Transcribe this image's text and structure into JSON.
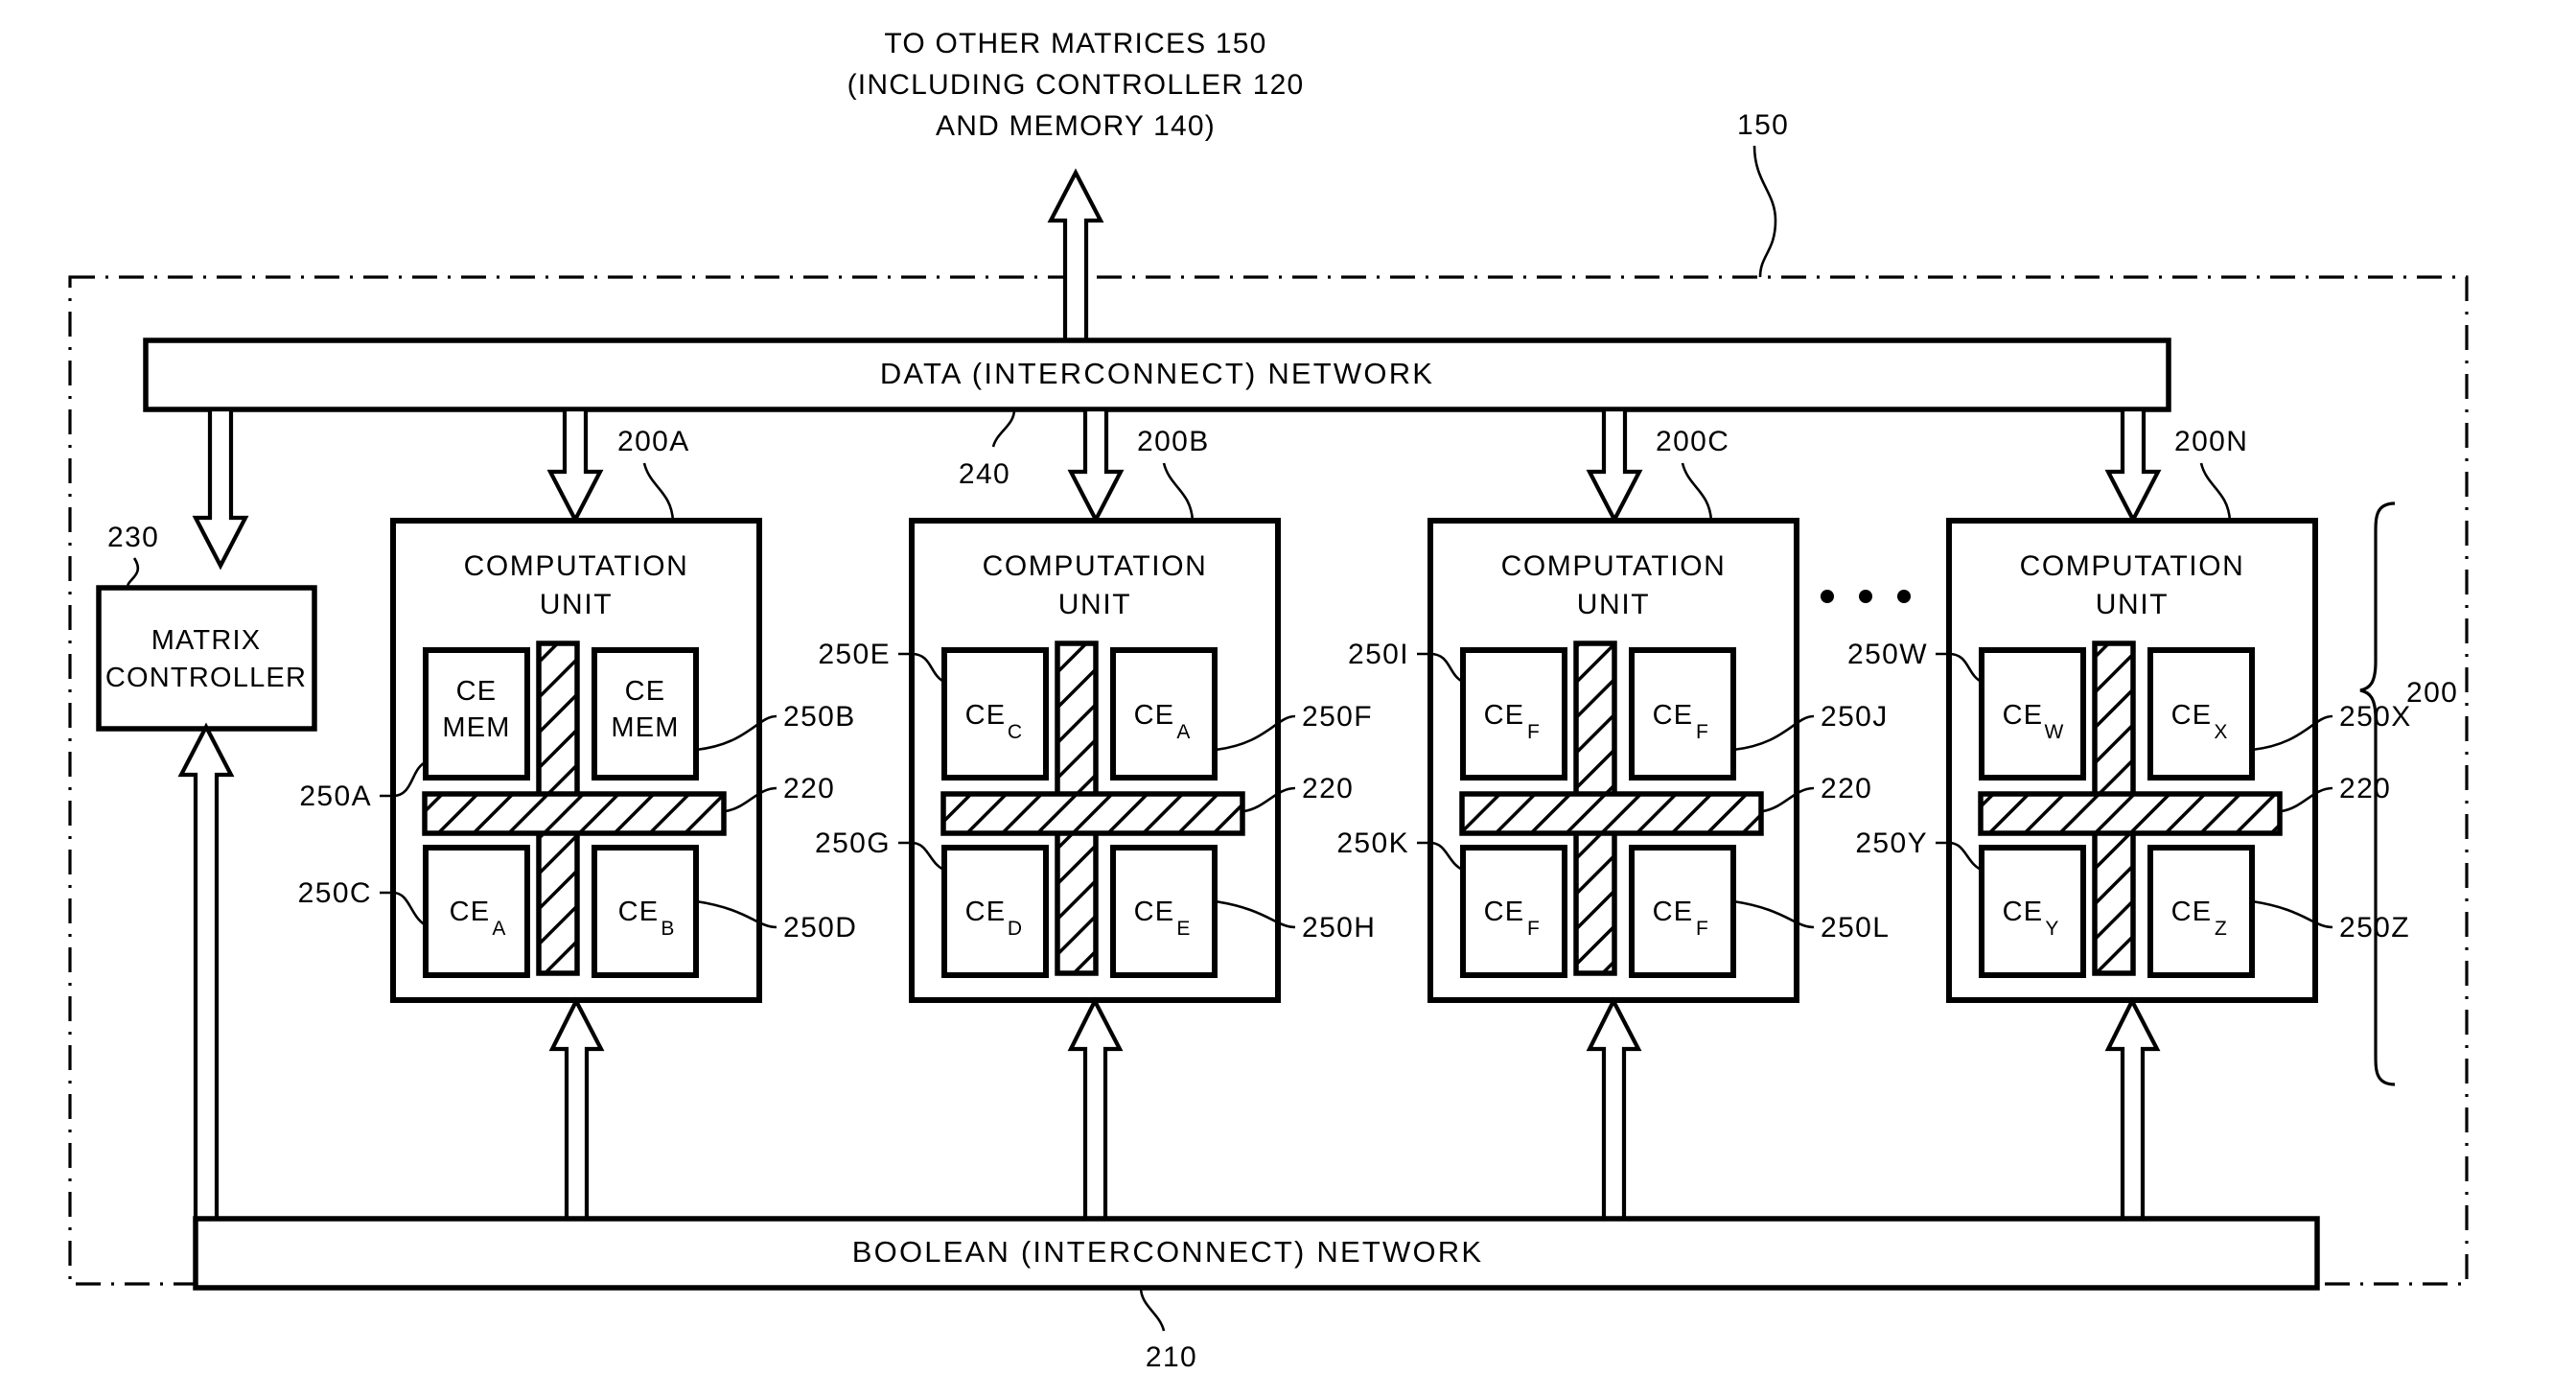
{
  "figure": {
    "top_note_lines": [
      "TO OTHER MATRICES 150",
      "(INCLUDING CONTROLLER 120",
      "AND MEMORY 140)"
    ],
    "outer_ref": "150",
    "data_network_label": "DATA (INTERCONNECT) NETWORK",
    "data_network_ref": "240",
    "boolean_network_label": "BOOLEAN (INTERCONNECT) NETWORK",
    "boolean_network_ref": "210",
    "matrix_controller_lines": [
      "MATRIX",
      "CONTROLLER"
    ],
    "matrix_controller_ref": "230",
    "matrix_brace_ref": "200",
    "ellipsis": "•  •  •",
    "unit_title_lines": [
      "COMPUTATION",
      "UNIT"
    ],
    "interconnect_ref": "220",
    "units": [
      {
        "ref": "200A",
        "cells": [
          {
            "label": "CE",
            "label2": "MEM",
            "sub": "",
            "ref": "250A",
            "ref_side": "left"
          },
          {
            "label": "CE",
            "label2": "MEM",
            "sub": "",
            "ref": "250B",
            "ref_side": "right"
          },
          {
            "label": "CE",
            "label2": "",
            "sub": "A",
            "ref": "250C",
            "ref_side": "left"
          },
          {
            "label": "CE",
            "label2": "",
            "sub": "B",
            "ref": "250D",
            "ref_side": "right"
          }
        ]
      },
      {
        "ref": "200B",
        "cells": [
          {
            "label": "CE",
            "label2": "",
            "sub": "C",
            "ref": "250E",
            "ref_side": "left"
          },
          {
            "label": "CE",
            "label2": "",
            "sub": "A",
            "ref": "250F",
            "ref_side": "right"
          },
          {
            "label": "CE",
            "label2": "",
            "sub": "D",
            "ref": "250G",
            "ref_side": "left"
          },
          {
            "label": "CE",
            "label2": "",
            "sub": "E",
            "ref": "250H",
            "ref_side": "right"
          }
        ]
      },
      {
        "ref": "200C",
        "cells": [
          {
            "label": "CE",
            "label2": "",
            "sub": "F",
            "ref": "250I",
            "ref_side": "left"
          },
          {
            "label": "CE",
            "label2": "",
            "sub": "F",
            "ref": "250J",
            "ref_side": "right"
          },
          {
            "label": "CE",
            "label2": "",
            "sub": "F",
            "ref": "250K",
            "ref_side": "left"
          },
          {
            "label": "CE",
            "label2": "",
            "sub": "F",
            "ref": "250L",
            "ref_side": "right"
          }
        ]
      },
      {
        "ref": "200N",
        "cells": [
          {
            "label": "CE",
            "label2": "",
            "sub": "W",
            "ref": "250W",
            "ref_side": "left"
          },
          {
            "label": "CE",
            "label2": "",
            "sub": "X",
            "ref": "250X",
            "ref_side": "right"
          },
          {
            "label": "CE",
            "label2": "",
            "sub": "Y",
            "ref": "250Y",
            "ref_side": "left"
          },
          {
            "label": "CE",
            "label2": "",
            "sub": "Z",
            "ref": "250Z",
            "ref_side": "right"
          }
        ]
      }
    ],
    "colors": {
      "ink": "#000000",
      "paper": "#ffffff"
    }
  }
}
